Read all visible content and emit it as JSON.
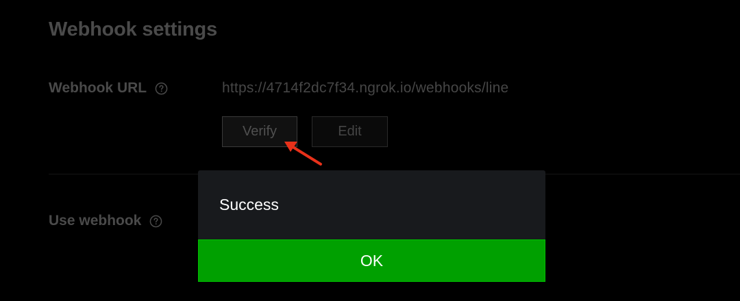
{
  "section": {
    "title": "Webhook settings"
  },
  "webhook_url": {
    "label": "Webhook URL",
    "help_icon": "question-circle-icon",
    "value": "https://4714f2dc7f34.ngrok.io/webhooks/line",
    "verify_label": "Verify",
    "edit_label": "Edit"
  },
  "use_webhook": {
    "label": "Use webhook",
    "help_icon": "question-circle-icon"
  },
  "dialog": {
    "message": "Success",
    "ok_label": "OK"
  },
  "colors": {
    "ok_button": "#00a000",
    "arrow": "#e8311a",
    "dialog_bg": "#181a1d"
  }
}
